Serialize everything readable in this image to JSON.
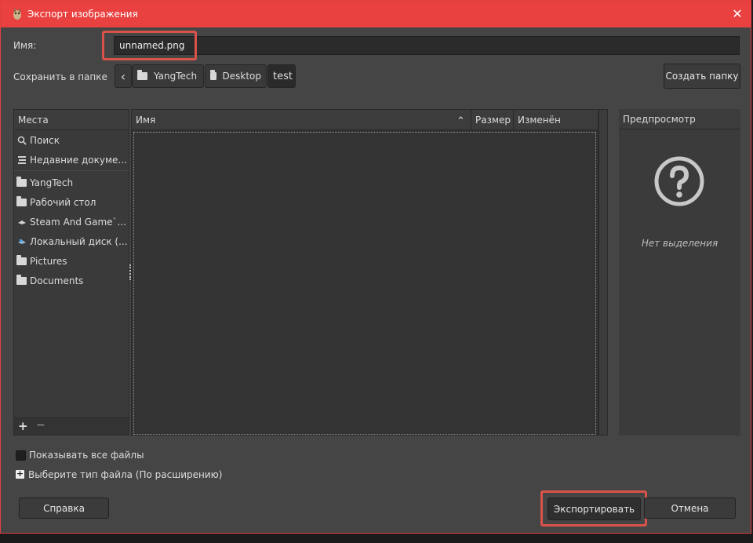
{
  "window": {
    "title": "Экспорт изображения",
    "close_glyph": "✕",
    "accent": "#e9413f",
    "highlight_color": "#d9534a"
  },
  "form": {
    "name_label": "Имя:",
    "name_value": "unnamed.png",
    "save_in_label": "Сохранить в папке"
  },
  "path_bar": {
    "back_glyph": "‹",
    "crumbs": [
      {
        "label": "YangTech",
        "icon": "folder-icon"
      },
      {
        "label": "Desktop",
        "icon": "folder-icon"
      },
      {
        "label": "test",
        "icon": ""
      }
    ],
    "create_folder": "Создать папку"
  },
  "places": {
    "header": "Места",
    "items": [
      {
        "label": "Поиск",
        "icon": "search-icon"
      },
      {
        "label": "Недавние докуме...",
        "icon": "recent-icon"
      },
      {
        "label": "YangTech",
        "icon": "folder-icon"
      },
      {
        "label": "Рабочий стол",
        "icon": "folder-icon"
      },
      {
        "label": "Steam And Game`...",
        "icon": "drive-icon"
      },
      {
        "label": "Локальный диск (...",
        "icon": "local-disk-icon"
      },
      {
        "label": "Pictures",
        "icon": "folder-icon"
      },
      {
        "label": "Documents",
        "icon": "folder-icon"
      }
    ],
    "add_glyph": "+",
    "remove_glyph": "−"
  },
  "files": {
    "columns": {
      "name": "Имя",
      "size": "Размер",
      "modified": "Изменён"
    },
    "sort_glyph": "⌃",
    "rows": []
  },
  "preview": {
    "header": "Предпросмотр",
    "no_selection": "Нет выделения"
  },
  "options": {
    "show_all_files": "Показывать все файлы",
    "show_all_checked": false,
    "file_type": "Выберите тип файла (По расширению)",
    "expander_glyph": "+"
  },
  "buttons": {
    "help": "Справка",
    "export": "Экспортировать",
    "cancel": "Отмена"
  }
}
